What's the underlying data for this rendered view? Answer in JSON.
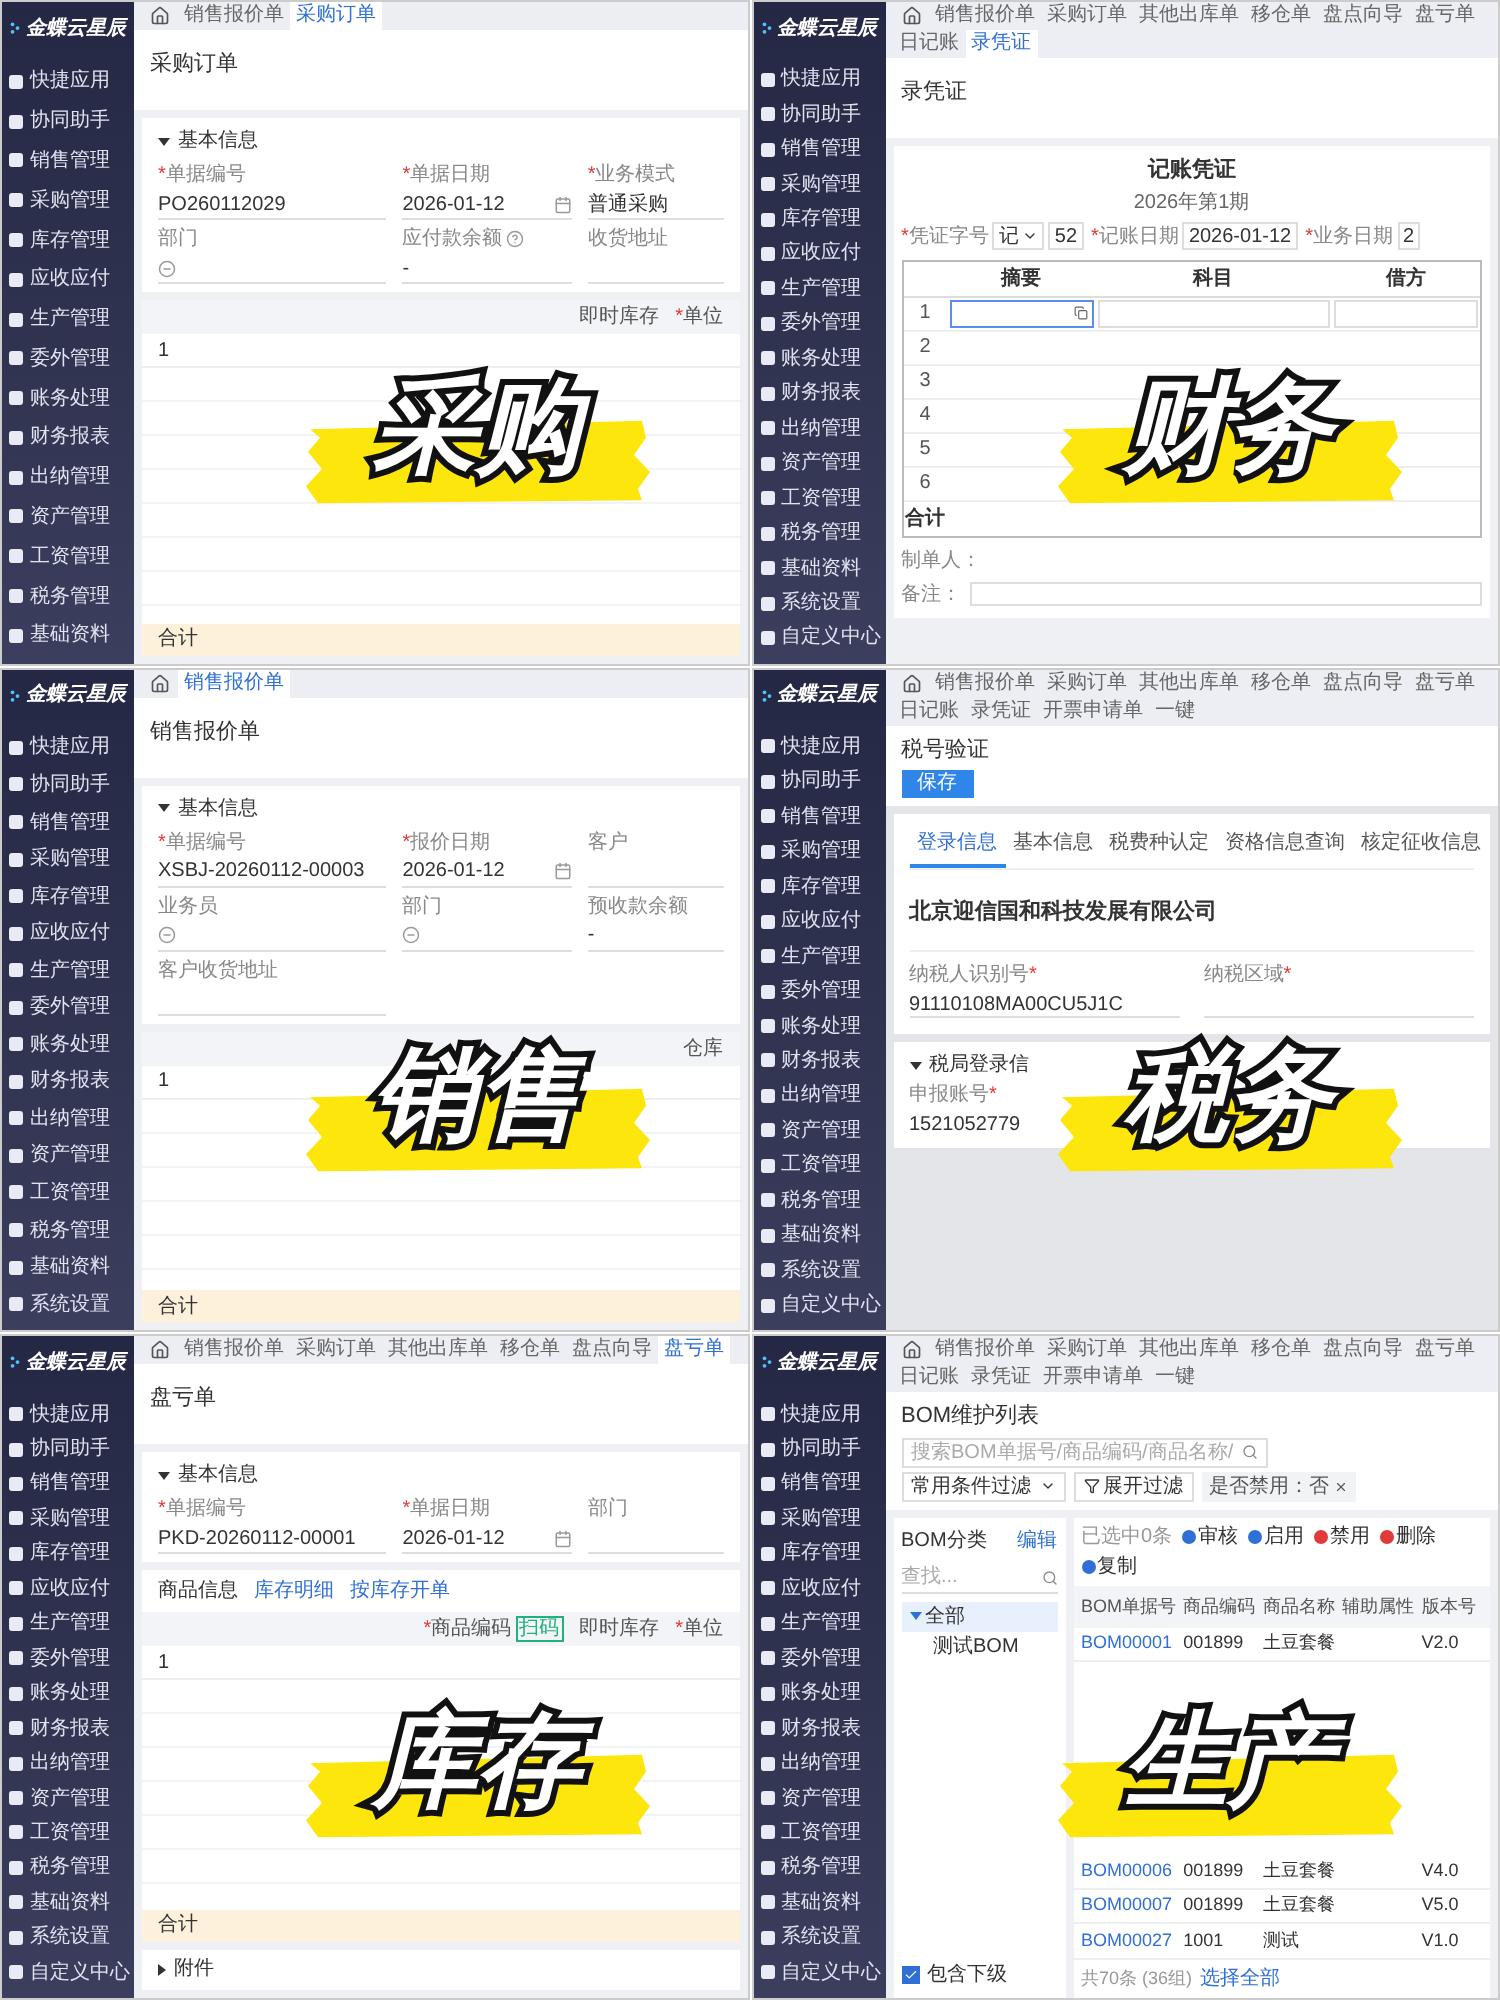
{
  "panels": [
    {
      "kind": "form",
      "overlay": "采购",
      "brand": "金蝶云星辰",
      "menu": [
        "快捷应用",
        "协同助手",
        "销售管理",
        "采购管理",
        "库存管理",
        "应收应付",
        "生产管理",
        "委外管理",
        "账务处理",
        "财务报表",
        "出纳管理",
        "资产管理",
        "工资管理",
        "税务管理",
        "基础资料"
      ],
      "tabs": [
        {
          "label": "销售报价单",
          "selected": false
        },
        {
          "label": "采购订单",
          "selected": true
        }
      ],
      "title": "采购订单",
      "section": "基本信息",
      "fields": [
        {
          "kind": "text",
          "label": "单据编号",
          "mark": "*",
          "value": "PO260112029"
        },
        {
          "kind": "date",
          "label": "单据日期",
          "mark": "*",
          "value": "2026-01-12"
        },
        {
          "kind": "text",
          "label": "业务模式",
          "mark": "*",
          "value": "普通采购"
        },
        {
          "kind": "select",
          "label": "部门"
        },
        {
          "kind": "help",
          "label": "应付款余额",
          "value": "-"
        },
        {
          "kind": "text",
          "label": "收货地址"
        }
      ],
      "columns": [
        {
          "label": "即时库存"
        },
        {
          "label": "单位",
          "mark": "*"
        }
      ],
      "row": "1",
      "total": "合计"
    },
    {
      "kind": "voucher",
      "overlay": "财务",
      "brand": "金蝶云星辰",
      "menu": [
        "快捷应用",
        "协同助手",
        "销售管理",
        "采购管理",
        "库存管理",
        "应收应付",
        "生产管理",
        "委外管理",
        "账务处理",
        "财务报表",
        "出纳管理",
        "资产管理",
        "工资管理",
        "税务管理",
        "基础资料",
        "系统设置",
        "自定义中心"
      ],
      "tabs": [
        {
          "label": "销售报价单",
          "selected": false
        },
        {
          "label": "采购订单",
          "selected": false
        },
        {
          "label": "其他出库单",
          "selected": false
        },
        {
          "label": "移仓单",
          "selected": false
        },
        {
          "label": "盘点向导",
          "selected": false
        },
        {
          "label": "盘亏单",
          "selected": false
        },
        {
          "label": "日记账",
          "selected": false
        },
        {
          "label": "录凭证",
          "selected": true
        }
      ],
      "title": "录凭证",
      "heading": "记账凭证",
      "period": "2026年第1期",
      "fields": [
        {
          "label": "凭证字号",
          "mark": "*",
          "select": "记",
          "value": "52"
        },
        {
          "label": "记账日期",
          "mark": "*",
          "value": "2026-01-12"
        },
        {
          "label": "业务日期",
          "mark": "*",
          "value": "2"
        }
      ],
      "columns": [
        "摘要",
        "科目",
        "借方"
      ],
      "rows": [
        "1",
        "2",
        "3",
        "4",
        "5",
        "6"
      ],
      "total": "合计",
      "maker": "制单人：",
      "note": "备注："
    },
    {
      "kind": "form",
      "overlay": "销售",
      "brand": "金蝶云星辰",
      "menu": [
        "快捷应用",
        "协同助手",
        "销售管理",
        "采购管理",
        "库存管理",
        "应收应付",
        "生产管理",
        "委外管理",
        "账务处理",
        "财务报表",
        "出纳管理",
        "资产管理",
        "工资管理",
        "税务管理",
        "基础资料",
        "系统设置"
      ],
      "tabs": [
        {
          "label": "销售报价单",
          "selected": true
        }
      ],
      "title": "销售报价单",
      "section": "基本信息",
      "fields": [
        {
          "kind": "text",
          "label": "单据编号",
          "mark": "*",
          "value": "XSBJ-20260112-00003"
        },
        {
          "kind": "date",
          "label": "报价日期",
          "mark": "*",
          "value": "2026-01-12"
        },
        {
          "kind": "text",
          "label": "客户"
        },
        {
          "kind": "select",
          "label": "业务员"
        },
        {
          "kind": "select",
          "label": "部门"
        },
        {
          "kind": "text",
          "label": "预收款余额",
          "value": "-"
        },
        {
          "kind": "text",
          "label": "客户收货地址"
        }
      ],
      "columns": [
        {
          "label": "仓库"
        }
      ],
      "row": "1",
      "total": "合计"
    },
    {
      "kind": "tax",
      "overlay": "税务",
      "brand": "金蝶云星辰",
      "menu": [
        "快捷应用",
        "协同助手",
        "销售管理",
        "采购管理",
        "库存管理",
        "应收应付",
        "生产管理",
        "委外管理",
        "账务处理",
        "财务报表",
        "出纳管理",
        "资产管理",
        "工资管理",
        "税务管理",
        "基础资料",
        "系统设置",
        "自定义中心"
      ],
      "tabs": [
        {
          "label": "销售报价单",
          "selected": false
        },
        {
          "label": "采购订单",
          "selected": false
        },
        {
          "label": "其他出库单",
          "selected": false
        },
        {
          "label": "移仓单",
          "selected": false
        },
        {
          "label": "盘点向导",
          "selected": false
        },
        {
          "label": "盘亏单",
          "selected": false
        },
        {
          "label": "日记账",
          "selected": false
        },
        {
          "label": "录凭证",
          "selected": false
        },
        {
          "label": "开票申请单",
          "selected": false
        },
        {
          "label": "一键",
          "selected": false
        }
      ],
      "title": "税号验证",
      "save": "保存",
      "subtabs": [
        {
          "label": "登录信息",
          "selected": true
        },
        {
          "label": "基本信息",
          "selected": false
        },
        {
          "label": "税费种认定",
          "selected": false
        },
        {
          "label": "资格信息查询",
          "selected": false
        },
        {
          "label": "核定征收信息",
          "selected": false
        }
      ],
      "company": "北京迎信国和科技发展有限公司",
      "fields": [
        {
          "label": "纳税人识别号",
          "mark": "*",
          "value": "91110108MA00CU5J1C"
        },
        {
          "label": "纳税区域",
          "mark": "*"
        }
      ],
      "section": "税局登录信",
      "account": {
        "label": "申报账号",
        "mark": "*",
        "value": "1521052779"
      }
    },
    {
      "kind": "form",
      "overlay": "库存",
      "brand": "金蝶云星辰",
      "menu": [
        "快捷应用",
        "协同助手",
        "销售管理",
        "采购管理",
        "库存管理",
        "应收应付",
        "生产管理",
        "委外管理",
        "账务处理",
        "财务报表",
        "出纳管理",
        "资产管理",
        "工资管理",
        "税务管理",
        "基础资料",
        "系统设置",
        "自定义中心"
      ],
      "tabs": [
        {
          "label": "销售报价单",
          "selected": false
        },
        {
          "label": "采购订单",
          "selected": false
        },
        {
          "label": "其他出库单",
          "selected": false
        },
        {
          "label": "移仓单",
          "selected": false
        },
        {
          "label": "盘点向导",
          "selected": false
        },
        {
          "label": "盘亏单",
          "selected": true
        }
      ],
      "title": "盘亏单",
      "section": "基本信息",
      "fields": [
        {
          "kind": "text",
          "label": "单据编号",
          "mark": "*",
          "value": "PKD-20260112-00001"
        },
        {
          "kind": "date",
          "label": "单据日期",
          "mark": "*",
          "value": "2026-01-12"
        },
        {
          "kind": "text",
          "label": "部门"
        }
      ],
      "goods": {
        "title": "商品信息",
        "links": [
          "库存明细",
          "按库存开单"
        ]
      },
      "columns": [
        {
          "label": "商品编码",
          "mark": "*",
          "tag": "扫码"
        },
        {
          "label": "即时库存"
        },
        {
          "label": "单位",
          "mark": "*"
        }
      ],
      "row": "1",
      "total": "合计",
      "attachment": "附件"
    },
    {
      "kind": "bom",
      "overlay": "生产",
      "brand": "金蝶云星辰",
      "menu": [
        "快捷应用",
        "协同助手",
        "销售管理",
        "采购管理",
        "库存管理",
        "应收应付",
        "生产管理",
        "委外管理",
        "账务处理",
        "财务报表",
        "出纳管理",
        "资产管理",
        "工资管理",
        "税务管理",
        "基础资料",
        "系统设置",
        "自定义中心"
      ],
      "tabs": [
        {
          "label": "销售报价单",
          "selected": false
        },
        {
          "label": "采购订单",
          "selected": false
        },
        {
          "label": "其他出库单",
          "selected": false
        },
        {
          "label": "移仓单",
          "selected": false
        },
        {
          "label": "盘点向导",
          "selected": false
        },
        {
          "label": "盘亏单",
          "selected": false
        },
        {
          "label": "日记账",
          "selected": false
        },
        {
          "label": "录凭证",
          "selected": false
        },
        {
          "label": "开票申请单",
          "selected": false
        },
        {
          "label": "一键",
          "selected": false
        }
      ],
      "title": "BOM维护列表",
      "search_placeholder": "搜索BOM单据号/商品编码/商品名称/",
      "filter": "常用条件过滤",
      "expand": "展开过滤",
      "chip": "是否禁用：否",
      "tree_title": "BOM分类",
      "edit": "编辑",
      "find_placeholder": "查找...",
      "tree": [
        {
          "label": "全部",
          "expanded": true,
          "children": [
            {
              "label": "测试BOM"
            }
          ]
        }
      ],
      "include": {
        "label": "包含下级",
        "checked": true
      },
      "selected_count": "已选中0条",
      "actions": [
        {
          "label": "审核",
          "color": "#2f6fd6"
        },
        {
          "label": "启用",
          "color": "#2f6fd6"
        },
        {
          "label": "禁用",
          "color": "#e03a3a"
        },
        {
          "label": "删除",
          "color": "#e03a3a"
        },
        {
          "label": "复制",
          "color": "#2f6fd6"
        }
      ],
      "columns": [
        "BOM单据号",
        "商品编码",
        "商品名称",
        "辅助属性",
        "版本号"
      ],
      "rows": [
        {
          "code": "BOM00001",
          "item": "001899",
          "name": "土豆套餐",
          "version": "V2.0"
        },
        {
          "code": "BOM00006",
          "item": "001899",
          "name": "土豆套餐",
          "version": "V4.0"
        },
        {
          "code": "BOM00007",
          "item": "001899",
          "name": "土豆套餐",
          "version": "V5.0"
        },
        {
          "code": "BOM00027",
          "item": "1001",
          "name": "测试",
          "version": "V1.0"
        }
      ],
      "footer": "共70条 (36组)",
      "select_all": "选择全部"
    }
  ]
}
